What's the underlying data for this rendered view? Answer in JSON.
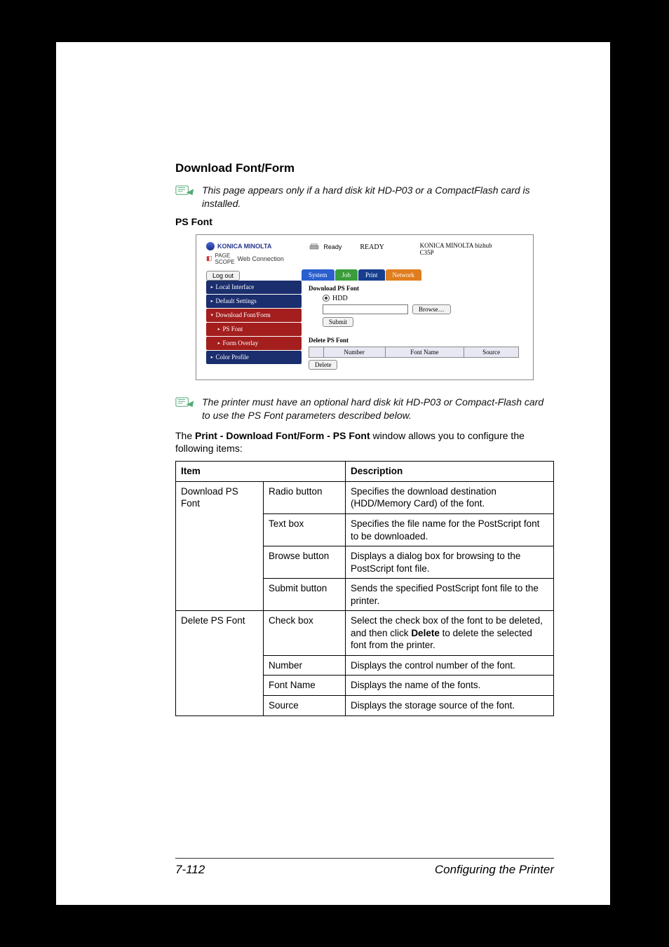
{
  "heading": "Download Font/Form",
  "notes": {
    "note1": "This page appears only if a hard disk kit HD-P03 or a CompactFlash card is installed.",
    "note2": "The printer must have an optional hard disk kit HD-P03 or Compact-Flash card to use the PS Font parameters described below."
  },
  "subheading": "PS Font",
  "screenshot": {
    "brand": "KONICA MINOLTA",
    "pagescope": "Web Connection",
    "status_ready": "Ready",
    "status_ready_caps": "READY",
    "model_line": "KONICA MINOLTA bizhub",
    "model_code": "C35P",
    "logout": "Log out",
    "tabs": [
      "System",
      "Job",
      "Print",
      "Network"
    ],
    "sidebar": [
      {
        "label": "Local Interface",
        "tri": "▸"
      },
      {
        "label": "Default Settings",
        "tri": "▸"
      },
      {
        "label": "Download Font/Form",
        "tri": "▾",
        "red": true
      },
      {
        "label": "PS Font",
        "tri": "▸",
        "sub": true,
        "red": true
      },
      {
        "label": "Form Overlay",
        "tri": "▸",
        "sub": true,
        "red": true
      },
      {
        "label": "Color Profile",
        "tri": "▸"
      }
    ],
    "section1_title": "Download PS Font",
    "radio_label": "HDD",
    "browse_btn": "Browse…",
    "submit_btn": "Submit",
    "section2_title": "Delete PS Font",
    "table_headers": [
      "",
      "Number",
      "Font Name",
      "Source"
    ],
    "delete_btn": "Delete"
  },
  "paragraph": {
    "prefix": "The ",
    "bold": "Print - Download Font/Form - PS Font",
    "suffix": " window allows you to configure the following items:"
  },
  "desc_table": {
    "headers": [
      "Item",
      "Description"
    ],
    "rows": [
      {
        "item": "Download PS Font",
        "ctrl": "Radio button",
        "desc": "Specifies the download destination (HDD/Memory Card) of the font.",
        "item_rowspan": 4
      },
      {
        "ctrl": "Text box",
        "desc": "Specifies the file name for the PostScript font to be downloaded."
      },
      {
        "ctrl": "Browse button",
        "desc": "Displays a dialog box for browsing to the PostScript font file."
      },
      {
        "ctrl": "Submit button",
        "desc": "Sends the specified PostScript font file to the printer."
      },
      {
        "item": "Delete PS Font",
        "ctrl": "Check box",
        "desc_pre": "Select the check box of the font to be deleted, and then click ",
        "desc_bold": "Delete",
        "desc_post": " to delete the selected font from the printer.",
        "item_rowspan": 4
      },
      {
        "ctrl": "Number",
        "desc": "Displays the control number of the font."
      },
      {
        "ctrl": "Font Name",
        "desc": "Displays the name of the fonts."
      },
      {
        "ctrl": "Source",
        "desc": "Displays the storage source of the font."
      }
    ]
  },
  "footer": {
    "page": "7-112",
    "title": "Configuring the Printer"
  }
}
